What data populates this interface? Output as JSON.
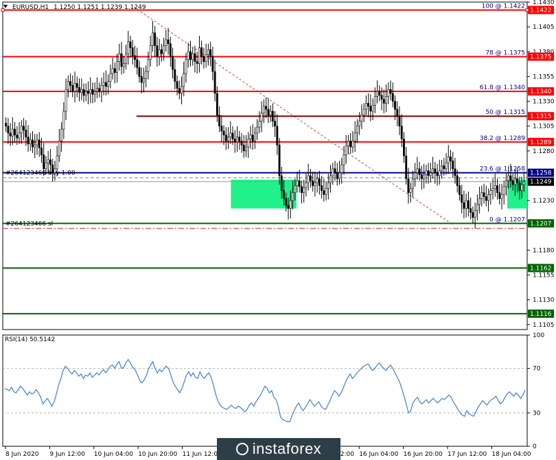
{
  "chart_data": [
    {
      "type": "candlestick",
      "title": "EURUSD,H1",
      "ohlc_label": [
        "1.1250",
        "1.1251",
        "1.1239",
        "1.1249"
      ],
      "ylim": [
        1.11,
        1.143
      ],
      "y_ticks": [
        "1.1430",
        "1.1405",
        "1.1380",
        "1.1355",
        "1.1330",
        "1.1305",
        "1.1280",
        "1.1230",
        "1.1205",
        "1.1180",
        "1.1155",
        "1.1130",
        "1.1105"
      ],
      "x_ticks": [
        "8 Jun 2020",
        "9 Jun 12:00",
        "10 Jun 04:00",
        "10 Jun 20:00",
        "11 Jun 12:00",
        "12 Jun 04:00",
        "12 Jun 20:00",
        "15 Jun 12:00",
        "16 Jun 04:00",
        "16 Jun 20:00",
        "17 Jun 12:00",
        "18 Jun 04:00"
      ],
      "current_price": "1.1249",
      "fib_levels": [
        {
          "label": "100 @ 1.1422",
          "value": 1.1422,
          "tag": "1.1422"
        },
        {
          "label": "78 @ 1.1375",
          "value": 1.1375,
          "tag": "1.1375"
        },
        {
          "label": "61.8 @ 1.1340",
          "value": 1.134,
          "tag": "1.1340"
        },
        {
          "label": "50 @ 1.1315",
          "value": 1.1315,
          "tag": "1.1315"
        },
        {
          "label": "38.2 @ 1.1289",
          "value": 1.1289,
          "tag": "1.1289"
        },
        {
          "label": "23.6 @ 1.1258",
          "value": 1.1258,
          "tag": "1.1258"
        },
        {
          "label": "0 @ 1.1207",
          "value": 1.1207,
          "tag": "1.1207"
        }
      ],
      "support_levels": [
        {
          "value": 1.1207,
          "tag": "1.1207"
        },
        {
          "value": 1.1162,
          "tag": "1.1162"
        },
        {
          "value": 1.1116,
          "tag": "1.1116"
        }
      ],
      "order_labels": [
        "#264123466 buy 1.00",
        "#264123466 sl"
      ],
      "stop_loss_level": 1.1202,
      "buy_level": 1.1258,
      "bid_level": 1.1249,
      "green_zones": [
        {
          "x_from": 0.435,
          "x_to": 0.56,
          "y_from": 1.1222,
          "y_to": 1.1251
        },
        {
          "x_from": 0.962,
          "x_to": 1.0,
          "y_from": 1.1222,
          "y_to": 1.1251
        }
      ],
      "trend_line": {
        "from": [
          0.25,
          1.1425
        ],
        "to": [
          0.86,
          1.1205
        ]
      },
      "closes": [
        1.1305,
        1.1298,
        1.1295,
        1.1302,
        1.1296,
        1.1293,
        1.1298,
        1.1305,
        1.1301,
        1.1294,
        1.1287,
        1.1291,
        1.1284,
        1.1286,
        1.1291,
        1.1283,
        1.1276,
        1.1262,
        1.1268,
        1.1271,
        1.1266,
        1.1258,
        1.1262,
        1.1275,
        1.129,
        1.1302,
        1.132,
        1.1342,
        1.135,
        1.1346,
        1.134,
        1.1348,
        1.1344,
        1.1339,
        1.1342,
        1.1336,
        1.134,
        1.1338,
        1.1342,
        1.1337,
        1.134,
        1.1343,
        1.134,
        1.1346,
        1.1349,
        1.1345,
        1.135,
        1.1358,
        1.1363,
        1.1359,
        1.137,
        1.1378,
        1.1365,
        1.1368,
        1.1378,
        1.139,
        1.1384,
        1.1376,
        1.1372,
        1.1364,
        1.1355,
        1.1349,
        1.1353,
        1.136,
        1.1372,
        1.1386,
        1.1399,
        1.1386,
        1.1375,
        1.1382,
        1.1378,
        1.1386,
        1.1392,
        1.1388,
        1.1375,
        1.1362,
        1.135,
        1.1343,
        1.1338,
        1.1345,
        1.1358,
        1.1372,
        1.138,
        1.1372,
        1.1378,
        1.137,
        1.1368,
        1.1384,
        1.1375,
        1.137,
        1.1377,
        1.1382,
        1.1375,
        1.136,
        1.1338,
        1.1316,
        1.1305,
        1.13,
        1.1296,
        1.129,
        1.1294,
        1.1298,
        1.1292,
        1.1289,
        1.1294,
        1.129,
        1.1286,
        1.128,
        1.1284,
        1.1292,
        1.1296,
        1.129,
        1.1298,
        1.1304,
        1.131,
        1.1318,
        1.1325,
        1.1322,
        1.1316,
        1.132,
        1.131,
        1.1305,
        1.1286,
        1.1255,
        1.124,
        1.1232,
        1.1225,
        1.1222,
        1.123,
        1.1238,
        1.1245,
        1.125,
        1.1244,
        1.1238,
        1.1243,
        1.1248,
        1.1255,
        1.125,
        1.1245,
        1.1248,
        1.1252,
        1.1245,
        1.124,
        1.1236,
        1.1242,
        1.1248,
        1.1255,
        1.1262,
        1.1258,
        1.1252,
        1.1258,
        1.1266,
        1.1276,
        1.1285,
        1.129,
        1.1284,
        1.129,
        1.1298,
        1.1305,
        1.131,
        1.1316,
        1.1322,
        1.1328,
        1.1325,
        1.132,
        1.1326,
        1.1335,
        1.134,
        1.1336,
        1.1332,
        1.1328,
        1.1335,
        1.1342,
        1.1338,
        1.133,
        1.1322,
        1.1315,
        1.1305,
        1.1292,
        1.1275,
        1.1252,
        1.1238,
        1.1242,
        1.1252,
        1.1258,
        1.1262,
        1.1256,
        1.1252,
        1.1256,
        1.126,
        1.1255,
        1.1258,
        1.1262,
        1.1258,
        1.1255,
        1.126,
        1.1265,
        1.1262,
        1.1268,
        1.1274,
        1.127,
        1.1262,
        1.1255,
        1.1245,
        1.1236,
        1.1228,
        1.1222,
        1.123,
        1.1222,
        1.1218,
        1.1213,
        1.122,
        1.1226,
        1.1232,
        1.1238,
        1.1234,
        1.123,
        1.1236,
        1.124,
        1.1242,
        1.1245,
        1.1238,
        1.1232,
        1.1236,
        1.1244,
        1.125,
        1.1255,
        1.125,
        1.1246,
        1.1252,
        1.1248,
        1.124,
        1.1246,
        1.1249
      ],
      "rsi": {
        "label": "RSI(14) 50.5142",
        "ylim": [
          0,
          100
        ],
        "y_ticks": [
          "100",
          "70",
          "30",
          "0"
        ],
        "levels": [
          70,
          30
        ],
        "values": [
          52,
          51,
          50,
          53,
          49,
          48,
          51,
          54,
          52,
          49,
          46,
          49,
          47,
          48,
          51,
          48,
          44,
          38,
          41,
          43,
          40,
          36,
          40,
          47,
          55,
          61,
          68,
          72,
          70,
          67,
          65,
          68,
          66,
          63,
          65,
          61,
          64,
          63,
          66,
          62,
          64,
          66,
          64,
          67,
          69,
          66,
          69,
          72,
          73,
          70,
          74,
          76,
          70,
          71,
          75,
          78,
          75,
          71,
          69,
          65,
          60,
          57,
          59,
          63,
          69,
          73,
          76,
          70,
          66,
          69,
          67,
          70,
          72,
          70,
          64,
          58,
          54,
          51,
          48,
          52,
          58,
          64,
          67,
          63,
          66,
          62,
          61,
          67,
          63,
          61,
          64,
          66,
          62,
          55,
          47,
          41,
          37,
          35,
          34,
          33,
          35,
          37,
          35,
          34,
          36,
          35,
          33,
          31,
          33,
          37,
          39,
          36,
          40,
          43,
          46,
          50,
          54,
          52,
          48,
          50,
          44,
          42,
          35,
          26,
          24,
          23,
          22,
          22,
          27,
          32,
          36,
          39,
          35,
          32,
          35,
          38,
          42,
          39,
          36,
          38,
          40,
          36,
          34,
          33,
          37,
          41,
          46,
          50,
          48,
          45,
          48,
          53,
          58,
          62,
          65,
          61,
          63,
          66,
          68,
          70,
          72,
          73,
          74,
          71,
          68,
          70,
          73,
          75,
          72,
          70,
          68,
          71,
          73,
          70,
          66,
          62,
          58,
          52,
          45,
          38,
          30,
          32,
          39,
          42,
          44,
          40,
          38,
          40,
          42,
          39,
          41,
          43,
          41,
          39,
          41,
          43,
          42,
          44,
          46,
          44,
          40,
          37,
          33,
          30,
          28,
          27,
          32,
          29,
          28,
          27,
          31,
          35,
          38,
          41,
          39,
          37,
          40,
          42,
          43,
          45,
          41,
          38,
          40,
          44,
          47,
          49,
          47,
          45,
          48,
          46,
          43,
          46,
          50.5
        ]
      }
    }
  ],
  "watermark": "instaforex"
}
